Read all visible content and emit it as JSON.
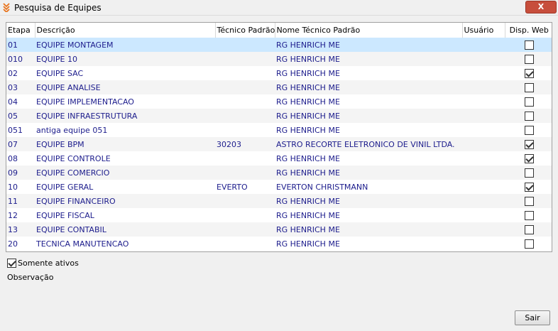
{
  "window": {
    "title": "Pesquisa de Equipes",
    "close_label": "X"
  },
  "grid": {
    "columns": [
      "Etapa",
      "Descrição",
      "Técnico Padrão",
      "Nome Técnico Padrão",
      "Usuário",
      "Disp. Web"
    ],
    "rows": [
      {
        "etapa": "01",
        "descricao": "EQUIPE MONTAGEM",
        "tecnico": "",
        "nome": "RG HENRICH ME",
        "usuario": "",
        "web": false
      },
      {
        "etapa": "010",
        "descricao": "EQUIPE 10",
        "tecnico": "",
        "nome": "RG HENRICH ME",
        "usuario": "",
        "web": false
      },
      {
        "etapa": "02",
        "descricao": "EQUIPE SAC",
        "tecnico": "",
        "nome": "RG HENRICH ME",
        "usuario": "",
        "web": true
      },
      {
        "etapa": "03",
        "descricao": "EQUIPE ANALISE",
        "tecnico": "",
        "nome": "RG HENRICH ME",
        "usuario": "",
        "web": false
      },
      {
        "etapa": "04",
        "descricao": "EQUIPE IMPLEMENTACAO",
        "tecnico": "",
        "nome": "RG HENRICH ME",
        "usuario": "",
        "web": false
      },
      {
        "etapa": "05",
        "descricao": "EQUIPE INFRAESTRUTURA",
        "tecnico": "",
        "nome": "RG HENRICH ME",
        "usuario": "",
        "web": false
      },
      {
        "etapa": "051",
        "descricao": "antiga equipe 051",
        "tecnico": "",
        "nome": "RG HENRICH ME",
        "usuario": "",
        "web": false
      },
      {
        "etapa": "07",
        "descricao": "EQUIPE BPM",
        "tecnico": "30203",
        "nome": "ASTRO RECORTE ELETRONICO DE VINIL LTDA.",
        "usuario": "",
        "web": true
      },
      {
        "etapa": "08",
        "descricao": "EQUIPE CONTROLE",
        "tecnico": "",
        "nome": "RG HENRICH ME",
        "usuario": "",
        "web": true
      },
      {
        "etapa": "09",
        "descricao": "EQUIPE COMERCIO",
        "tecnico": "",
        "nome": "RG HENRICH ME",
        "usuario": "",
        "web": false
      },
      {
        "etapa": "10",
        "descricao": "EQUIPE GERAL",
        "tecnico": "EVERTO",
        "nome": "EVERTON CHRISTMANN",
        "usuario": "",
        "web": true
      },
      {
        "etapa": "11",
        "descricao": "EQUIPE FINANCEIRO",
        "tecnico": "",
        "nome": "RG HENRICH ME",
        "usuario": "",
        "web": false
      },
      {
        "etapa": "12",
        "descricao": "EQUIPE FISCAL",
        "tecnico": "",
        "nome": "RG HENRICH ME",
        "usuario": "",
        "web": false
      },
      {
        "etapa": "13",
        "descricao": "EQUIPE CONTABIL",
        "tecnico": "",
        "nome": "RG HENRICH ME",
        "usuario": "",
        "web": false
      },
      {
        "etapa": "20",
        "descricao": "TECNICA MANUTENCAO",
        "tecnico": "",
        "nome": "RG HENRICH ME",
        "usuario": "",
        "web": false
      }
    ]
  },
  "filters": {
    "somente_ativos_label": "Somente ativos",
    "somente_ativos_checked": true
  },
  "observacao_label": "Observação",
  "buttons": {
    "sair_label": "Sair"
  },
  "colors": {
    "selected_row": "#cce8ff",
    "cell_text": "#1c1c8c",
    "close_button": "#c74e3c",
    "icon_orange": "#e8731c"
  }
}
